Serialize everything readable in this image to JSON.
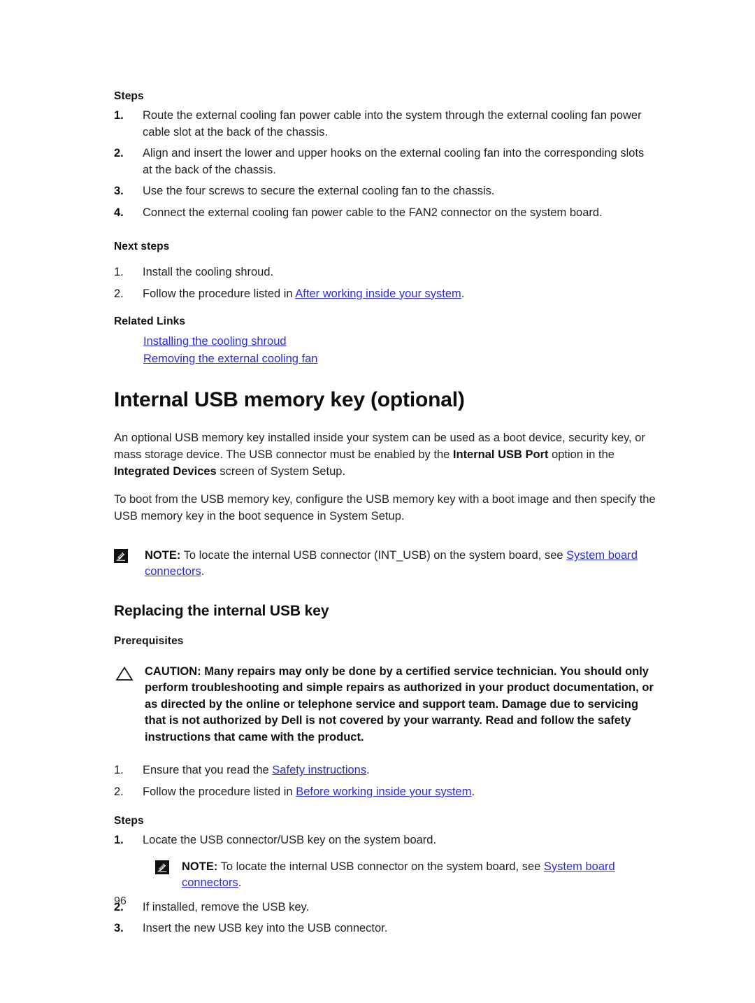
{
  "document": {
    "page_number": "96",
    "link_color": "#2b2be0",
    "text_color": "#222222"
  },
  "fan_section": {
    "steps_label": "Steps",
    "steps": [
      {
        "num": "1.",
        "text": "Route the external cooling fan power cable into the system through the external cooling fan power cable slot at the back of the chassis."
      },
      {
        "num": "2.",
        "text": "Align and insert the lower and upper hooks on the external cooling fan into the corresponding slots at the back of the chassis."
      },
      {
        "num": "3.",
        "text": "Use the four screws to secure the external cooling fan to the chassis."
      },
      {
        "num": "4.",
        "text": "Connect the external cooling fan power cable to the FAN2 connector on the system board."
      }
    ],
    "next_steps_label": "Next steps",
    "next_steps": [
      {
        "num": "1.",
        "text": "Install the cooling shroud.",
        "link": "",
        "tail": ""
      },
      {
        "num": "2.",
        "text": "Follow the procedure listed in ",
        "link": "After working inside your system",
        "tail": "."
      }
    ],
    "related_links_label": "Related Links",
    "related_links": [
      "Installing the cooling shroud",
      "Removing the external cooling fan"
    ]
  },
  "usb_section": {
    "title": "Internal USB memory key (optional)",
    "paragraph1": {
      "part1": "An optional USB memory key installed inside your system can be used as a boot device, security key, or mass storage device. The USB connector must be enabled by the ",
      "bold1": "Internal USB Port",
      "part2": " option in the ",
      "bold2": "Integrated Devices",
      "part3": " screen of System Setup."
    },
    "paragraph2": "To boot from the USB memory key, configure the USB memory key with a boot image and then specify the USB memory key in the boot sequence in System Setup.",
    "note": {
      "icon": "note-pencil-icon",
      "lead": "NOTE:",
      "text": " To locate the internal USB connector (INT_USB) on the system board, see ",
      "link": "System board connectors",
      "tail": "."
    }
  },
  "replacing_section": {
    "title": "Replacing the internal USB key",
    "prerequisites_label": "Prerequisites",
    "caution": {
      "icon": "caution-triangle-icon",
      "text": "CAUTION: Many repairs may only be done by a certified service technician. You should only perform troubleshooting and simple repairs as authorized in your product documentation, or as directed by the online or telephone service and support team. Damage due to servicing that is not authorized by Dell is not covered by your warranty. Read and follow the safety instructions that came with the product."
    },
    "prereq_steps": [
      {
        "num": "1.",
        "text": "Ensure that you read the ",
        "link": "Safety instructions",
        "tail": "."
      },
      {
        "num": "2.",
        "text": "Follow the procedure listed in ",
        "link": "Before working inside your system",
        "tail": "."
      }
    ],
    "steps_label": "Steps",
    "step1": {
      "num": "1.",
      "text": "Locate the USB connector/USB key on the system board."
    },
    "step1_note": {
      "icon": "note-pencil-icon",
      "lead": "NOTE:",
      "text": " To locate the internal USB connector on the system board, see ",
      "link": "System board connectors",
      "tail": "."
    },
    "step2": {
      "num": "2.",
      "text": "If installed, remove the USB key."
    },
    "step3": {
      "num": "3.",
      "text": "Insert the new USB key into the USB connector."
    }
  }
}
